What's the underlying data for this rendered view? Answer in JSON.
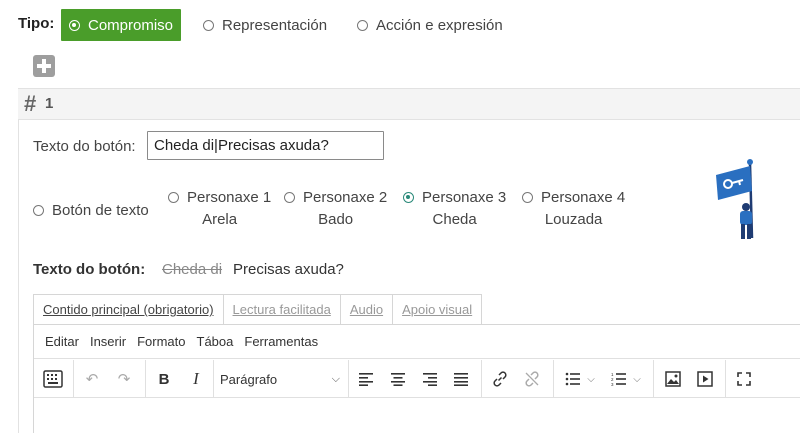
{
  "tipo": {
    "label": "Tipo:",
    "options": [
      {
        "label": "Compromiso",
        "selected": true
      },
      {
        "label": "Representación",
        "selected": false
      },
      {
        "label": "Acción e expresión",
        "selected": false
      }
    ]
  },
  "section": {
    "number": "1"
  },
  "button_text": {
    "label": "Texto do botón:",
    "value": "Cheda di|Precisas axuda?"
  },
  "button_style": {
    "text_option": "Botón de texto",
    "characters": [
      {
        "line1": "Personaxe 1",
        "line2": "Arela",
        "selected": false
      },
      {
        "line1": "Personaxe 2",
        "line2": "Bado",
        "selected": false
      },
      {
        "line1": "Personaxe 3",
        "line2": "Cheda",
        "selected": true
      },
      {
        "line1": "Personaxe 4",
        "line2": "Louzada",
        "selected": false
      }
    ]
  },
  "preview": {
    "label": "Texto do botón:",
    "struck": "Cheda di",
    "text": "Precisas axuda?"
  },
  "editor": {
    "tabs": [
      "Contido principal (obrigatorio)",
      "Lectura facilitada",
      "Audio",
      "Apoio visual"
    ],
    "menus": [
      "Editar",
      "Inserir",
      "Formato",
      "Táboa",
      "Ferramentas"
    ],
    "block_format": "Parágrafo"
  },
  "colors": {
    "accent": "#4a9d2a",
    "radio_selected": "#2b8a7a",
    "mascot_flag": "#2a6fc0"
  }
}
